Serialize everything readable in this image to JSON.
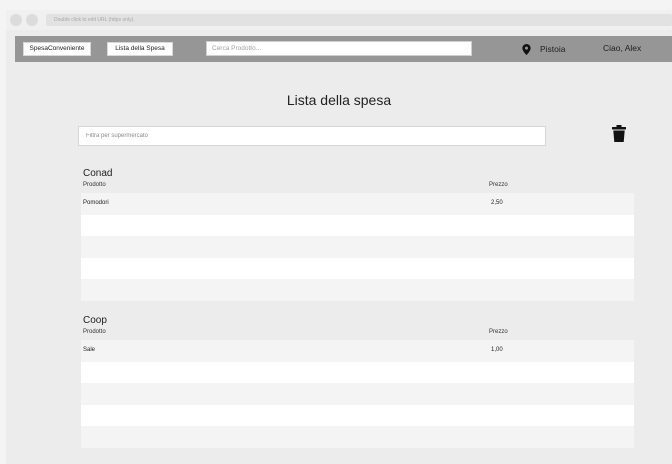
{
  "browser": {
    "url_hint": "Double click to edit URL (https only)."
  },
  "navbar": {
    "brand_button": "SpesaConveniente",
    "list_button": "Lista della Spesa",
    "search_placeholder": "Cerca Prodotto...",
    "location_icon": "map-pin-icon",
    "city": "Pistoia",
    "greeting": "Ciao, Alex"
  },
  "page": {
    "title": "Lista della spesa",
    "filter_placeholder": "Filtra per supermercato",
    "delete_icon": "trash-icon"
  },
  "stores": [
    {
      "name": "Conad",
      "col_product": "Prodotto",
      "col_price": "Prezzo",
      "items": [
        {
          "product": "Pomodori",
          "price": "2,50"
        },
        {
          "product": "",
          "price": ""
        },
        {
          "product": "",
          "price": ""
        },
        {
          "product": "",
          "price": ""
        },
        {
          "product": "",
          "price": ""
        }
      ]
    },
    {
      "name": "Coop",
      "col_product": "Prodotto",
      "col_price": "Prezzo",
      "items": [
        {
          "product": "Sale",
          "price": "1,00"
        },
        {
          "product": "",
          "price": ""
        },
        {
          "product": "",
          "price": ""
        },
        {
          "product": "",
          "price": ""
        },
        {
          "product": "",
          "price": ""
        }
      ]
    }
  ]
}
